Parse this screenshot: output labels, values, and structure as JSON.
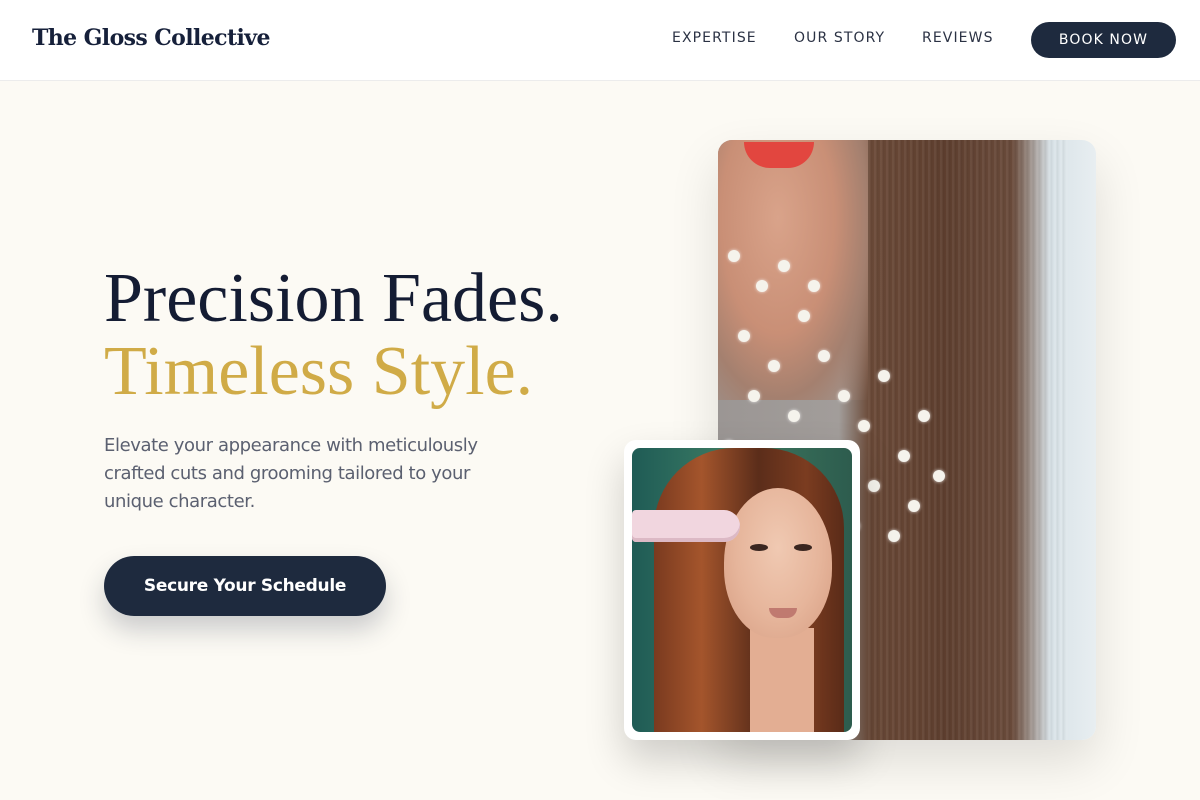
{
  "header": {
    "brand": "The Gloss Collective",
    "nav": [
      {
        "label": "EXPERTISE"
      },
      {
        "label": "OUR STORY"
      },
      {
        "label": "REVIEWS"
      }
    ],
    "book_label": "BOOK NOW"
  },
  "hero": {
    "headline_line1": "Precision Fades.",
    "headline_line2": "Timeless Style.",
    "subtext": "Elevate your appearance with meticulously crafted cuts and grooming tailored to your unique character.",
    "cta_label": "Secure Your Schedule"
  },
  "colors": {
    "background": "#fcfaf4",
    "navy": "#1e2a3e",
    "gold": "#d0ab47"
  }
}
